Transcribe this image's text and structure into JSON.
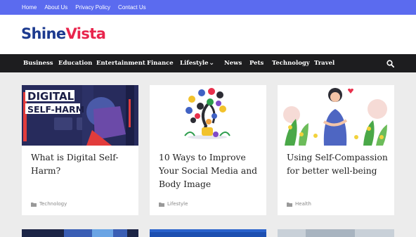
{
  "top_links": [
    "Home",
    "About Us",
    "Privacy Policy",
    "Contact Us"
  ],
  "logo": {
    "part1": "Shine",
    "part2": "Vista"
  },
  "nav": [
    "Business",
    "Education",
    "Entertainment",
    "Finance",
    "Lifestyle",
    "News",
    "Pets",
    "Technology",
    "Travel"
  ],
  "thumb_text": {
    "line1": "DIGITAL",
    "line2": "SELF-HARM"
  },
  "posts": [
    {
      "title": "What is Digital Self-Harm?",
      "category": "Technology"
    },
    {
      "title": "10 Ways to Improve Your Social Media and Body Image",
      "category": "Lifestyle"
    },
    {
      "title": "Using Self-Compassion for better well-being",
      "category": "Health"
    }
  ],
  "colors": {
    "topbar": "#5b6bef",
    "logo_primary": "#1c3a8f",
    "logo_accent": "#e8244c",
    "navbar": "#1d1d1f",
    "page_bg": "#ececec"
  }
}
